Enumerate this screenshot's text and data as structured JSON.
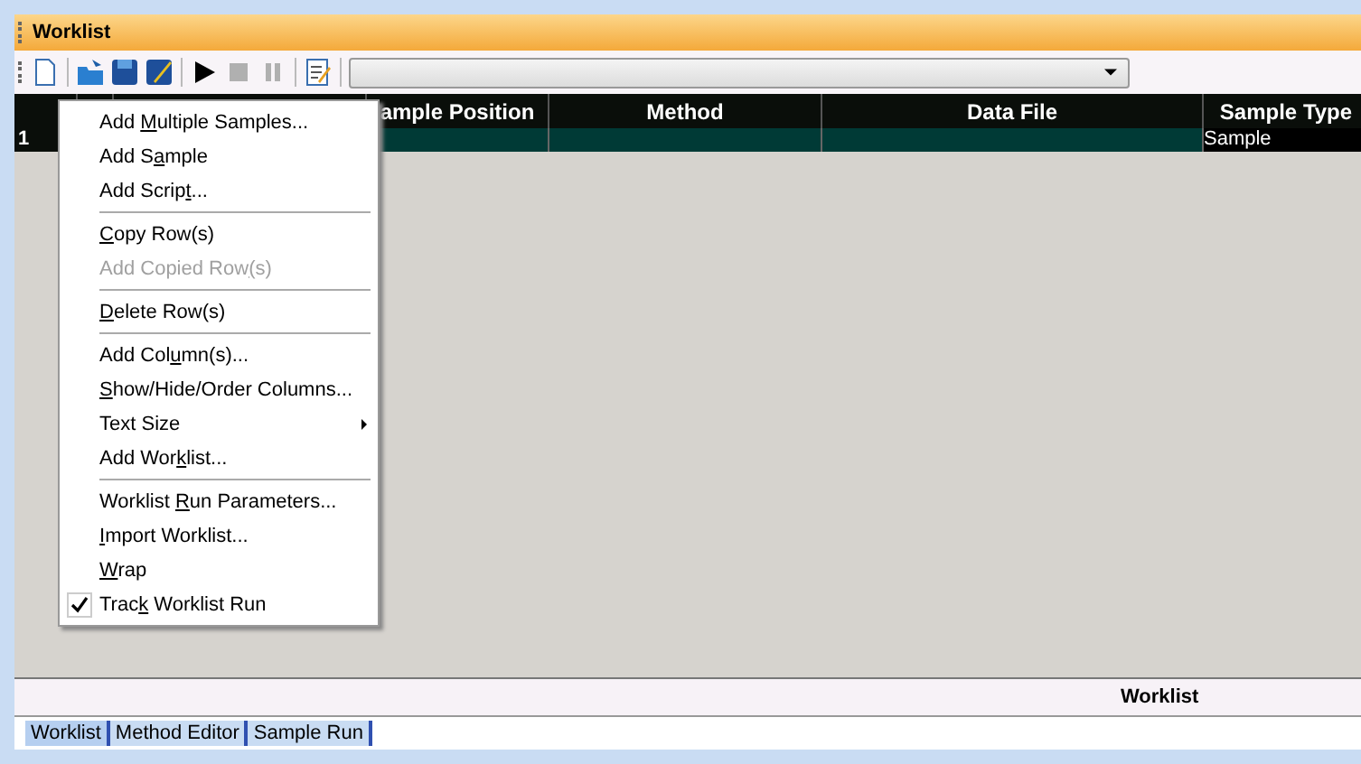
{
  "window": {
    "title": "Worklist"
  },
  "table": {
    "columns": [
      {},
      {},
      {},
      {
        "label": "ample Position"
      },
      {
        "label": "Method"
      },
      {
        "label": "Data File"
      },
      {
        "label": "Sample Type"
      }
    ],
    "rows": [
      {
        "cells": [
          "1",
          "",
          "",
          "",
          "",
          "",
          "Sample"
        ]
      }
    ]
  },
  "context_menu": {
    "groups": [
      [
        {
          "before": "Add ",
          "key": "M",
          "after": "ultiple Samples...",
          "disabled": false,
          "checked": false,
          "submenu": false
        },
        {
          "before": "Add S",
          "key": "a",
          "after": "mple",
          "disabled": false,
          "checked": false,
          "submenu": false
        },
        {
          "before": "Add Scrip",
          "key": "t",
          "after": "...",
          "disabled": false,
          "checked": false,
          "submenu": false
        }
      ],
      [
        {
          "key": "C",
          "after": "opy Row(s)",
          "disabled": false,
          "checked": false,
          "submenu": false
        },
        {
          "before": "Add Copied Row",
          "key": "(",
          "after": "s)",
          "disabled": true,
          "checked": false,
          "submenu": false
        }
      ],
      [
        {
          "key": "D",
          "after": "elete Row(s)",
          "disabled": false,
          "checked": false,
          "submenu": false
        }
      ],
      [
        {
          "before": "Add Col",
          "key": "u",
          "after": "mn(s)...",
          "disabled": false,
          "checked": false,
          "submenu": false
        },
        {
          "key": "S",
          "after": "how/Hide/Order Columns...",
          "disabled": false,
          "checked": false,
          "submenu": false
        },
        {
          "before": "Text Size",
          "disabled": false,
          "checked": false,
          "submenu": true
        },
        {
          "before": "Add Wor",
          "key": "k",
          "after": "list...",
          "disabled": false,
          "checked": false,
          "submenu": false
        }
      ],
      [
        {
          "before": "Worklist ",
          "key": "R",
          "after": "un Parameters...",
          "disabled": false,
          "checked": false,
          "submenu": false
        },
        {
          "key": "I",
          "after": "mport Worklist...",
          "disabled": false,
          "checked": false,
          "submenu": false
        },
        {
          "key": "W",
          "after": "rap",
          "disabled": false,
          "checked": false,
          "submenu": false
        },
        {
          "before": "Trac",
          "key": "k",
          "after": " Worklist Run",
          "disabled": false,
          "checked": true,
          "submenu": false
        }
      ]
    ]
  },
  "status_bar": {
    "label": "Worklist"
  },
  "bottom_tabs": [
    {
      "label": "Worklist",
      "selected": true
    },
    {
      "label": "Method Editor",
      "selected": false
    },
    {
      "label": "Sample Run",
      "selected": false
    }
  ]
}
